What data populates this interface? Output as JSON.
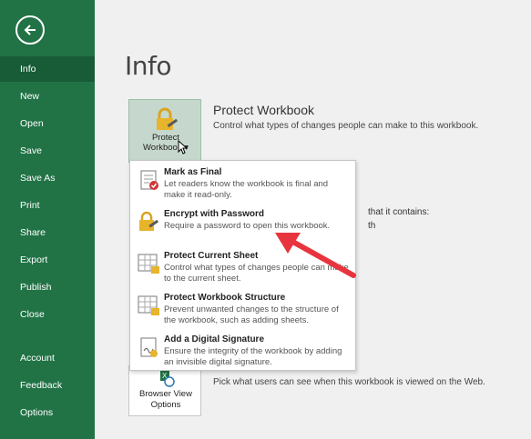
{
  "colors": {
    "sidebar": "#217346",
    "sidebar_active": "#185c37",
    "arrow": "#e8343e",
    "tile": "#c6d8cd"
  },
  "sidebar": {
    "back_icon": "back-arrow-icon",
    "items": [
      {
        "label": "Info",
        "active": true
      },
      {
        "label": "New"
      },
      {
        "label": "Open"
      },
      {
        "label": "Save"
      },
      {
        "label": "Save As"
      },
      {
        "label": "Print"
      },
      {
        "label": "Share"
      },
      {
        "label": "Export"
      },
      {
        "label": "Publish"
      },
      {
        "label": "Close"
      },
      {
        "label": "Account"
      },
      {
        "label": "Feedback"
      },
      {
        "label": "Options"
      }
    ]
  },
  "main": {
    "title": "Info",
    "protect": {
      "tile_line1": "Protect",
      "tile_line2": "Workbook",
      "title": "Protect Workbook",
      "description": "Control what types of changes people can make to this workbook."
    },
    "inspect_fragments": {
      "line1": "that it contains:",
      "line2": "th"
    },
    "browser_view": {
      "tile_line1": "Browser View",
      "tile_line2": "Options",
      "description": "Pick what users can see when this workbook is viewed on the Web."
    }
  },
  "menu": {
    "items": [
      {
        "title": "Mark as Final",
        "description": "Let readers know the workbook is final and make it read-only.",
        "icon": "mark-final-icon"
      },
      {
        "title": "Encrypt with Password",
        "description": "Require a password to open this workbook.",
        "icon": "lock-key-icon"
      },
      {
        "title": "Protect Current Sheet",
        "description": "Control what types of changes people can make to the current sheet.",
        "icon": "sheet-lock-icon"
      },
      {
        "title": "Protect Workbook Structure",
        "description": "Prevent unwanted changes to the structure of the workbook, such as adding sheets.",
        "icon": "structure-lock-icon"
      },
      {
        "title": "Add a Digital Signature",
        "description": "Ensure the integrity of the workbook by adding an invisible digital signature.",
        "icon": "signature-icon"
      }
    ]
  }
}
